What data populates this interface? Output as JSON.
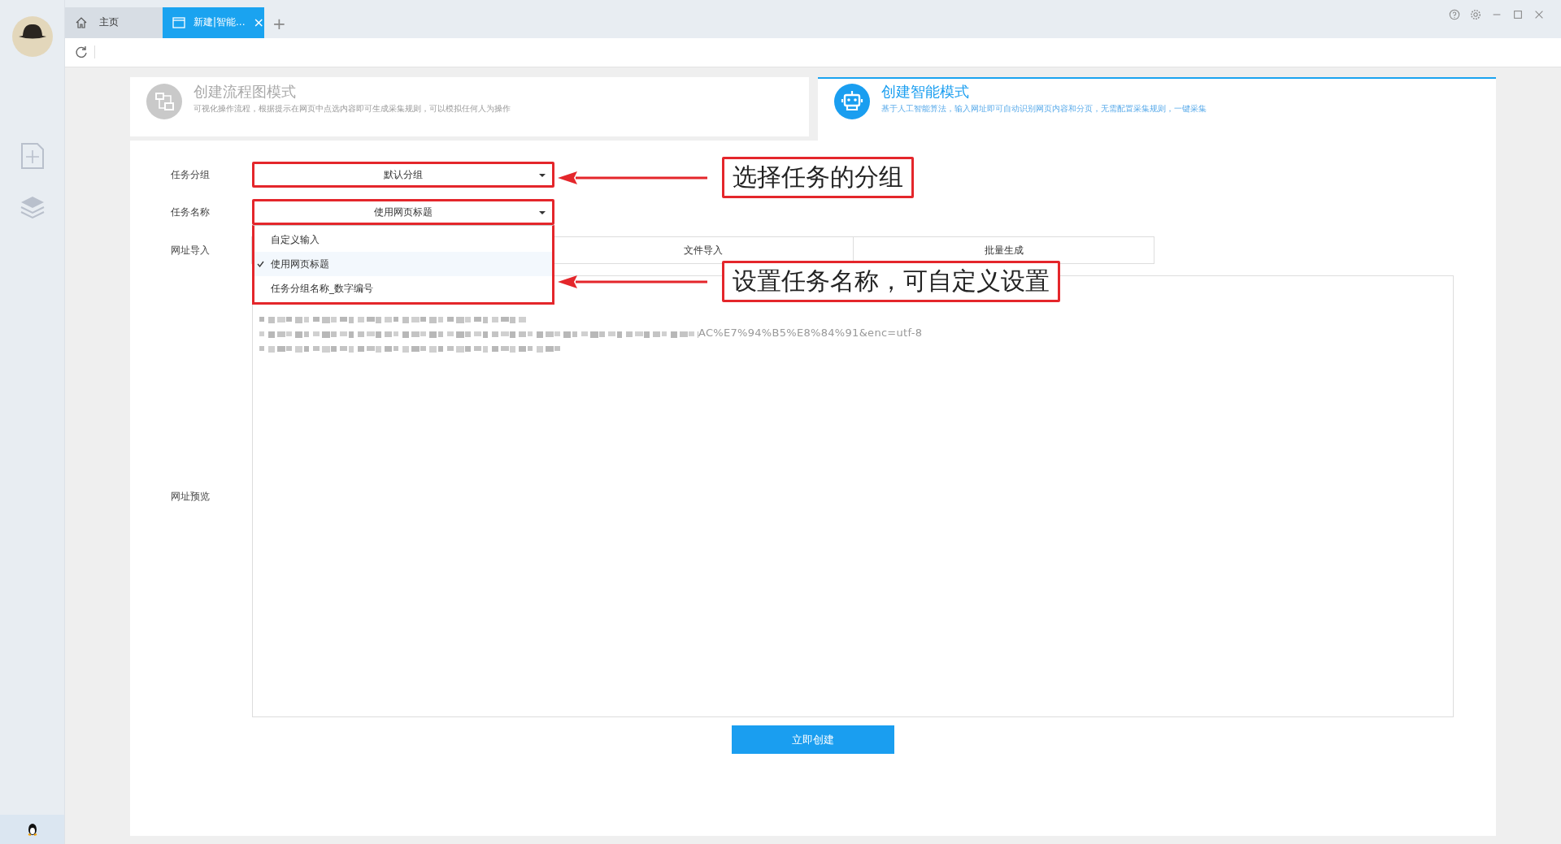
{
  "tabs": [
    {
      "label": "主页",
      "kind": "home",
      "selected": false
    },
    {
      "label": "新建|智能...",
      "kind": "page",
      "selected": true,
      "close": "×"
    }
  ],
  "new_tab": "+",
  "mode_cards": [
    {
      "kind": "flow",
      "title": "创建流程图模式",
      "description": "可视化操作流程，根据提示在网页中点选内容即可生成采集规则，可以模拟任何人为操作",
      "selected": false
    },
    {
      "kind": "smart",
      "title": "创建智能模式",
      "description": "基于人工智能算法，输入网址即可自动识别网页内容和分页，无需配置采集规则，一键采集",
      "selected": true
    }
  ],
  "form": [
    {
      "kind": "select",
      "label": "任务分组",
      "value": "默认分组",
      "annotation": "选择任务的分组"
    },
    {
      "kind": "select",
      "label": "任务名称",
      "value": "使用网页标题",
      "annotation": "设置任务名称，可自定义设置",
      "expanded": true,
      "options": [
        {
          "label": "自定义输入",
          "selected": false
        },
        {
          "label": "使用网页标题",
          "selected": true
        },
        {
          "label": "任务分组名称_数字编号",
          "selected": false
        }
      ]
    },
    {
      "kind": "tabs",
      "label": "网址导入",
      "tabs": [
        {
          "label": "文件导入",
          "selected": false
        },
        {
          "label": "批量生成",
          "selected": false
        }
      ]
    },
    {
      "kind": "preview",
      "label": "网址预览",
      "visible_text": "AC%E7%94%B5%E8%84%91&enc=utf-8"
    }
  ],
  "create_button": "立即创建"
}
